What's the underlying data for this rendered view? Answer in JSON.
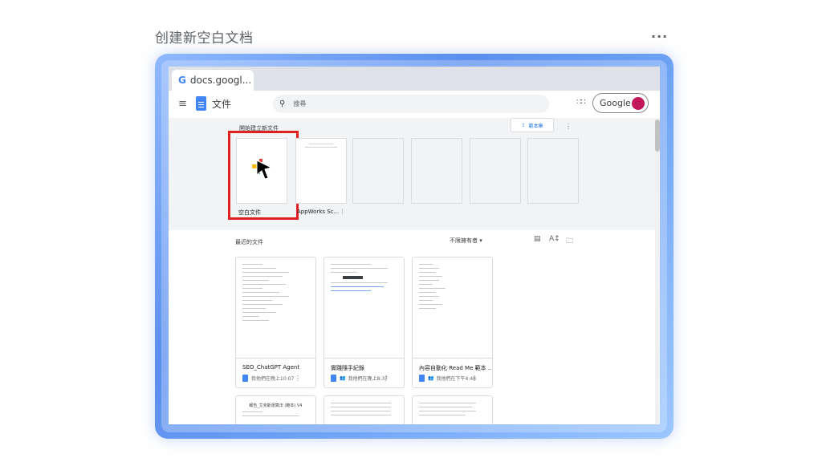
{
  "page": {
    "title": "创建新空白文档",
    "more_label": "···"
  },
  "browser": {
    "tab_title": "docs.googl...",
    "tab_favicon": "G"
  },
  "appbar": {
    "menu_icon": "≡",
    "app_name": "文件",
    "search_placeholder": "搜尋",
    "search_icon": "🔍",
    "apps_icon": "⋮⋮⋮",
    "account_label": "Google"
  },
  "templates": {
    "section_title": "開始建立新文件",
    "gallery_button": "範本庫",
    "gallery_icon": "⇪",
    "more_icon": "⋮",
    "items": [
      {
        "label": "空白文件"
      },
      {
        "label": "AppWorks Sc..."
      },
      {
        "label": ""
      },
      {
        "label": ""
      },
      {
        "label": ""
      },
      {
        "label": ""
      }
    ]
  },
  "recent": {
    "section_title": "最近的文件",
    "owner_filter": "不限擁有者 ▾",
    "list_view_icon": "▤",
    "sort_icon": "A↕",
    "folder_icon": "🗀",
    "docs": [
      {
        "title": "SEO_ChatGPT Agent",
        "meta": "我他們在晚上10:07",
        "shared": false
      },
      {
        "title": "實踐隨手紀錄",
        "meta": "我他們在晚上8:37",
        "shared": true
      },
      {
        "title": "內容自動化 Read Me 範本 ...",
        "meta": "我他們在下午4:48",
        "shared": true
      }
    ],
    "row_two": [
      {
        "title": "報告_艾克斯運算法 (範本) V4"
      },
      {
        "title": ""
      },
      {
        "title": ""
      }
    ]
  },
  "colors": {
    "accent": "#1a73e8",
    "highlight": "#e02020",
    "frame": "#5b8fef",
    "avatar": "#c2185b"
  }
}
